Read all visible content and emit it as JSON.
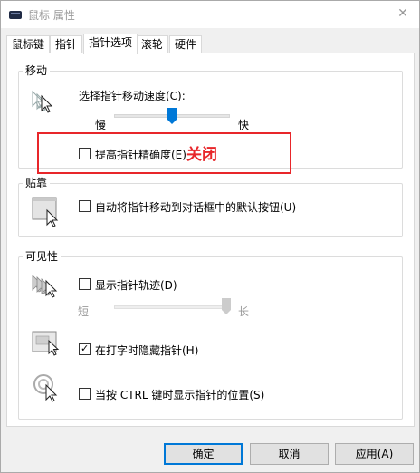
{
  "window": {
    "title": "鼠标 属性",
    "close_glyph": "✕"
  },
  "tabs": [
    {
      "label": "鼠标键"
    },
    {
      "label": "指针"
    },
    {
      "label": "指针选项"
    },
    {
      "label": "滚轮"
    },
    {
      "label": "硬件"
    }
  ],
  "active_tab": "指针选项",
  "motion": {
    "group_title": "移动",
    "speed_label": "选择指针移动速度(C):",
    "slow_label": "慢",
    "fast_label": "快",
    "speed_level": 0.5,
    "precision_label": "提高指针精确度(E)",
    "precision_checked": false
  },
  "annotation": {
    "text": "关闭",
    "color": "#e8262a"
  },
  "snap": {
    "group_title": "贴靠",
    "snap_label": "自动将指针移动到对话框中的默认按钮(U)",
    "snap_checked": false
  },
  "visibility": {
    "group_title": "可见性",
    "trails_label": "显示指针轨迹(D)",
    "trails_checked": false,
    "short_label": "短",
    "long_label": "长",
    "trails_length_level": 1.0,
    "hide_label": "在打字时隐藏指针(H)",
    "hide_checked": true,
    "ctrl_label": "当按 CTRL 键时显示指针的位置(S)",
    "ctrl_checked": false
  },
  "buttons": {
    "ok": "确定",
    "cancel": "取消",
    "apply": "应用(A)"
  },
  "colors": {
    "accent": "#0078d7",
    "annotation": "#e8262a"
  },
  "icons": [
    "mouse-icon",
    "pointer-speed-icon",
    "snap-to-icon",
    "pointer-trails-icon",
    "hide-pointer-icon",
    "pointer-location-icon"
  ]
}
